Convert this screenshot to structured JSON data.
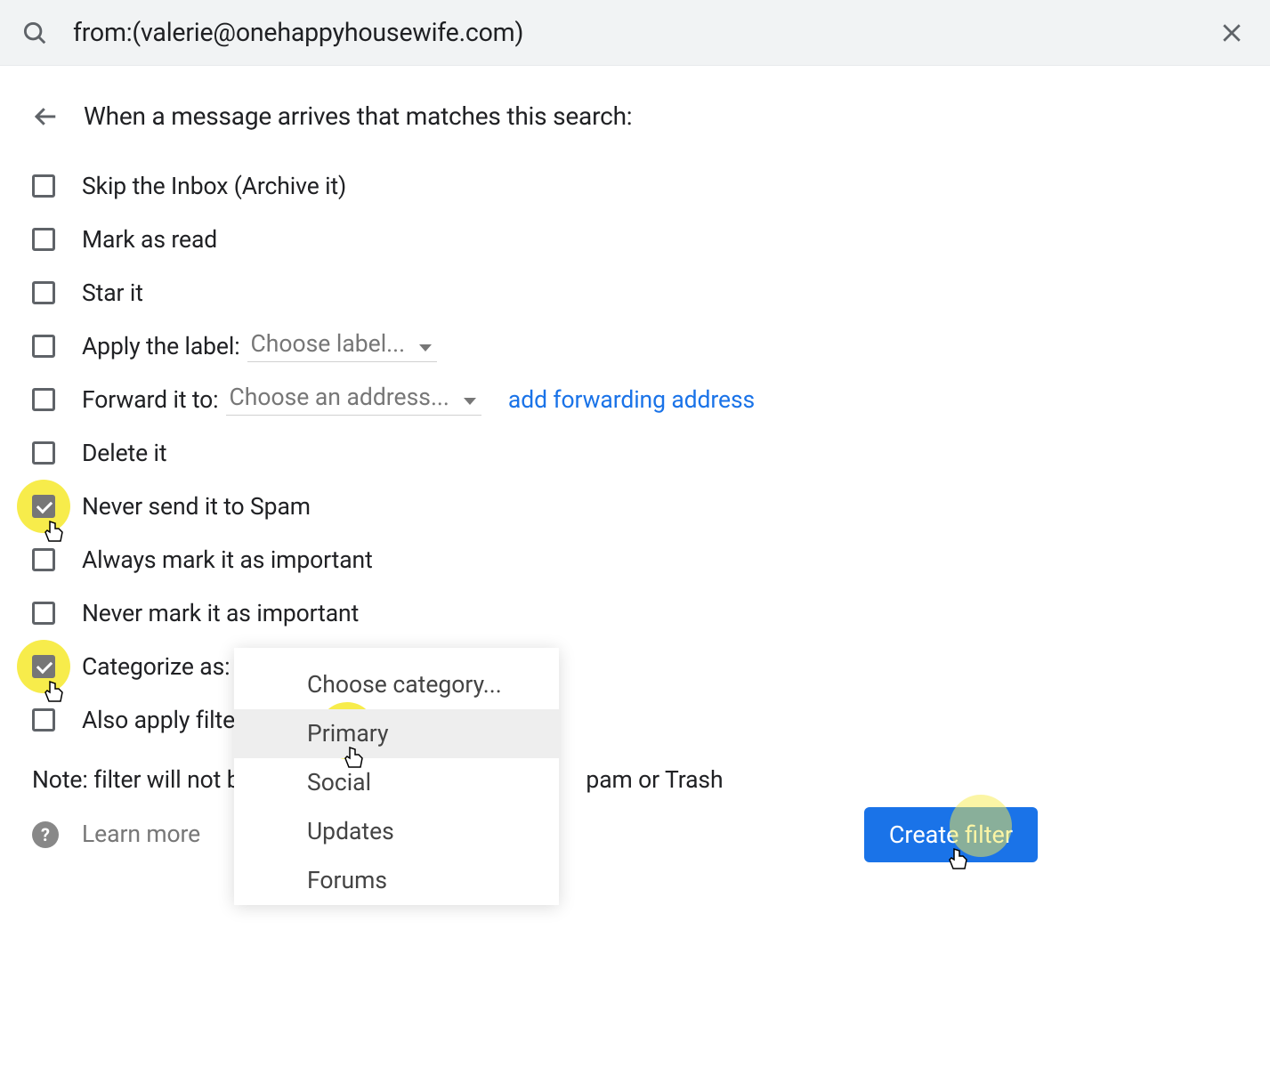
{
  "search": {
    "value": "from:(valerie@onehappyhousewife.com)"
  },
  "header": {
    "title": "When a message arrives that matches this search:"
  },
  "options": {
    "skip_inbox": "Skip the Inbox (Archive it)",
    "mark_read": "Mark as read",
    "star_it": "Star it",
    "apply_label": "Apply the label:",
    "apply_label_value": "Choose label...",
    "forward_to": "Forward it to:",
    "forward_value": "Choose an address...",
    "forward_link": "add forwarding address",
    "delete_it": "Delete it",
    "never_spam": "Never send it to Spam",
    "always_important": "Always mark it as important",
    "never_important": "Never mark it as important",
    "categorize_as": "Categorize as:",
    "also_apply": "Also apply filter"
  },
  "note": {
    "prefix": "Note: filter will not be",
    "suffix": "pam or Trash"
  },
  "footer": {
    "learn_more": "Learn more",
    "create_filter": "Create filter"
  },
  "categories": {
    "choose": "Choose category...",
    "primary": "Primary",
    "social": "Social",
    "updates": "Updates",
    "forums": "Forums"
  }
}
